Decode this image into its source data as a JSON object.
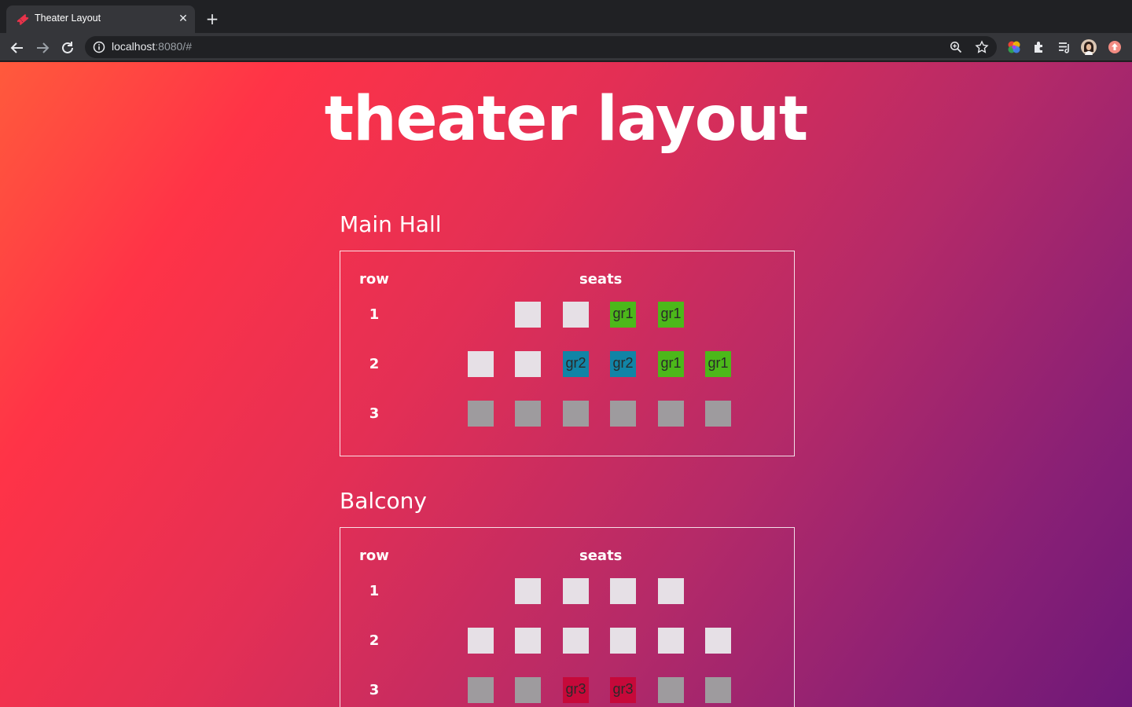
{
  "browser": {
    "tab_title": "Theater Layout",
    "url_host": "localhost",
    "url_rest": ":8080/#"
  },
  "page": {
    "title": "theater layout"
  },
  "halls": [
    {
      "name": "Main Hall",
      "col_row": "row",
      "col_seats": "seats",
      "rows": [
        {
          "num": "1",
          "seats": [
            {
              "state": "free",
              "label": ""
            },
            {
              "state": "free",
              "label": ""
            },
            {
              "state": "gr1",
              "label": "gr1"
            },
            {
              "state": "gr1",
              "label": "gr1"
            }
          ]
        },
        {
          "num": "2",
          "seats": [
            {
              "state": "free",
              "label": ""
            },
            {
              "state": "free",
              "label": ""
            },
            {
              "state": "gr2",
              "label": "gr2"
            },
            {
              "state": "gr2",
              "label": "gr2"
            },
            {
              "state": "gr1",
              "label": "gr1"
            },
            {
              "state": "gr1",
              "label": "gr1"
            }
          ]
        },
        {
          "num": "3",
          "seats": [
            {
              "state": "taken",
              "label": ""
            },
            {
              "state": "taken",
              "label": ""
            },
            {
              "state": "taken",
              "label": ""
            },
            {
              "state": "taken",
              "label": ""
            },
            {
              "state": "taken",
              "label": ""
            },
            {
              "state": "taken",
              "label": ""
            }
          ]
        }
      ]
    },
    {
      "name": "Balcony",
      "col_row": "row",
      "col_seats": "seats",
      "rows": [
        {
          "num": "1",
          "seats": [
            {
              "state": "free",
              "label": ""
            },
            {
              "state": "free",
              "label": ""
            },
            {
              "state": "free",
              "label": ""
            },
            {
              "state": "free",
              "label": ""
            }
          ]
        },
        {
          "num": "2",
          "seats": [
            {
              "state": "free",
              "label": ""
            },
            {
              "state": "free",
              "label": ""
            },
            {
              "state": "free",
              "label": ""
            },
            {
              "state": "free",
              "label": ""
            },
            {
              "state": "free",
              "label": ""
            },
            {
              "state": "free",
              "label": ""
            }
          ]
        },
        {
          "num": "3",
          "seats": [
            {
              "state": "taken",
              "label": ""
            },
            {
              "state": "taken",
              "label": ""
            },
            {
              "state": "gr3",
              "label": "gr3"
            },
            {
              "state": "gr3",
              "label": "gr3"
            },
            {
              "state": "taken",
              "label": ""
            },
            {
              "state": "taken",
              "label": ""
            }
          ]
        }
      ]
    }
  ],
  "colors": {
    "free": "#e6e0e6",
    "taken": "#9e9b9e",
    "gr1": "#4cb81a",
    "gr2": "#1184a6",
    "gr3": "#c6093a"
  }
}
